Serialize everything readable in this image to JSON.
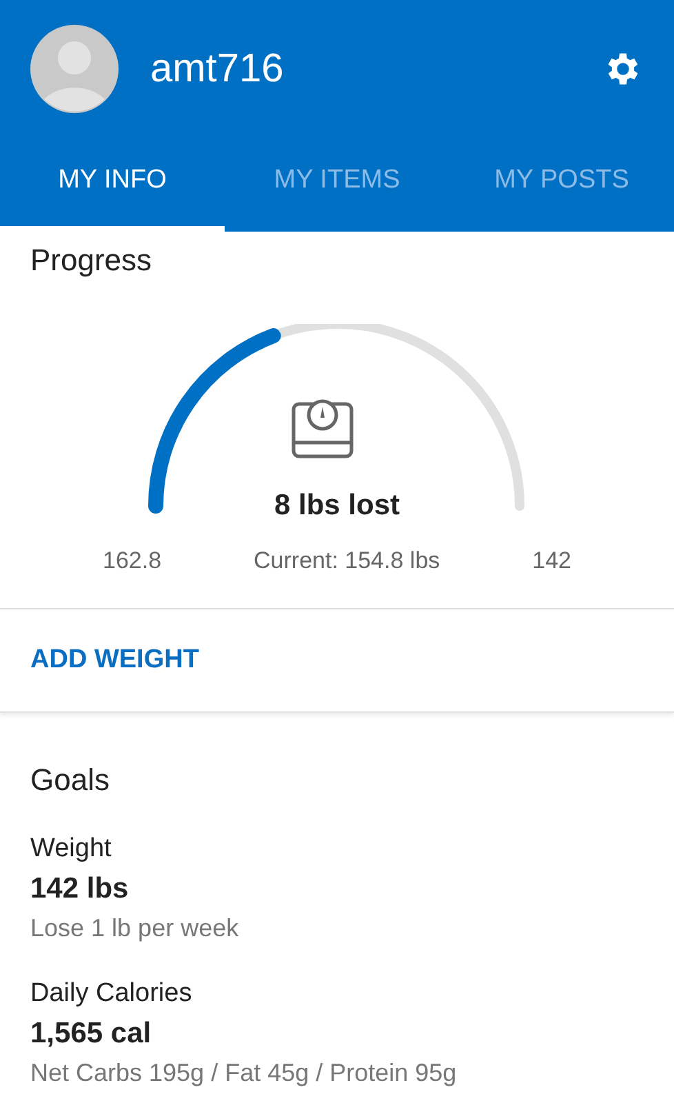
{
  "header": {
    "username": "amt716"
  },
  "tabs": [
    {
      "label": "MY INFO",
      "selected": true
    },
    {
      "label": "MY ITEMS",
      "selected": false
    },
    {
      "label": "MY POSTS",
      "selected": false
    }
  ],
  "progress": {
    "title": "Progress",
    "lost": "8 lbs lost",
    "start": "162.8",
    "current": "Current: 154.8 lbs",
    "goal": "142"
  },
  "add_weight": "ADD WEIGHT",
  "goals": {
    "title": "Goals",
    "items": [
      {
        "label": "Weight",
        "value": "142 lbs",
        "detail": "Lose 1 lb per week"
      },
      {
        "label": "Daily Calories",
        "value": "1,565 cal",
        "detail": "Net Carbs 195g / Fat 45g / Protein 95g"
      }
    ]
  }
}
